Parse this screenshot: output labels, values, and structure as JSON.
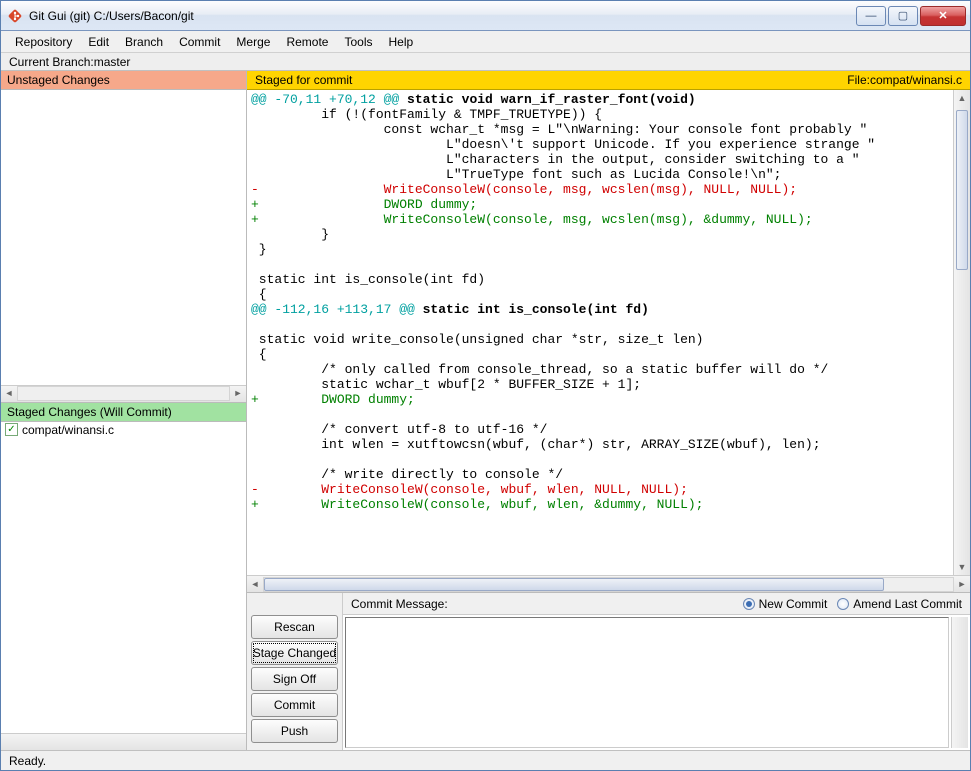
{
  "window": {
    "title": "Git Gui (git) C:/Users/Bacon/git"
  },
  "menu": {
    "items": [
      "Repository",
      "Edit",
      "Branch",
      "Commit",
      "Merge",
      "Remote",
      "Tools",
      "Help"
    ]
  },
  "branch_label_prefix": "Current Branch: ",
  "branch_name": "master",
  "panels": {
    "unstaged_header": "Unstaged Changes",
    "staged_header": "Staged Changes (Will Commit)"
  },
  "staged_files": [
    {
      "name": "compat/winansi.c"
    }
  ],
  "diff_header": {
    "left": "Staged for commit",
    "file_prefix": "File:  ",
    "file": "compat/winansi.c"
  },
  "diff_lines": [
    {
      "cls": "hunk",
      "t": "@@ -70,11 +70,12 @@",
      "bold": " static void warn_if_raster_font(void)"
    },
    {
      "cls": "ctx",
      "t": "         if (!(fontFamily & TMPF_TRUETYPE)) {"
    },
    {
      "cls": "ctx",
      "t": "                 const wchar_t *msg = L\"\\nWarning: Your console font probably \""
    },
    {
      "cls": "ctx",
      "t": "                         L\"doesn\\'t support Unicode. If you experience strange \""
    },
    {
      "cls": "ctx",
      "t": "                         L\"characters in the output, consider switching to a \""
    },
    {
      "cls": "ctx",
      "t": "                         L\"TrueType font such as Lucida Console!\\n\";"
    },
    {
      "cls": "del",
      "t": "-                WriteConsoleW(console, msg, wcslen(msg), NULL, NULL);"
    },
    {
      "cls": "add",
      "t": "+                DWORD dummy;"
    },
    {
      "cls": "add",
      "t": "+                WriteConsoleW(console, msg, wcslen(msg), &dummy, NULL);"
    },
    {
      "cls": "ctx",
      "t": "         }"
    },
    {
      "cls": "ctx",
      "t": " }"
    },
    {
      "cls": "ctx",
      "t": " "
    },
    {
      "cls": "ctx",
      "t": " static int is_console(int fd)"
    },
    {
      "cls": "ctx",
      "t": " {"
    },
    {
      "cls": "hunk",
      "t": "@@ -112,16 +113,17 @@",
      "bold": " static int is_console(int fd)"
    },
    {
      "cls": "ctx",
      "t": " "
    },
    {
      "cls": "ctx",
      "t": " static void write_console(unsigned char *str, size_t len)"
    },
    {
      "cls": "ctx",
      "t": " {"
    },
    {
      "cls": "ctx",
      "t": "         /* only called from console_thread, so a static buffer will do */"
    },
    {
      "cls": "ctx",
      "t": "         static wchar_t wbuf[2 * BUFFER_SIZE + 1];"
    },
    {
      "cls": "add",
      "t": "+        DWORD dummy;"
    },
    {
      "cls": "ctx",
      "t": " "
    },
    {
      "cls": "ctx",
      "t": "         /* convert utf-8 to utf-16 */"
    },
    {
      "cls": "ctx",
      "t": "         int wlen = xutftowcsn(wbuf, (char*) str, ARRAY_SIZE(wbuf), len);"
    },
    {
      "cls": "ctx",
      "t": " "
    },
    {
      "cls": "ctx",
      "t": "         /* write directly to console */"
    },
    {
      "cls": "del",
      "t": "-        WriteConsoleW(console, wbuf, wlen, NULL, NULL);"
    },
    {
      "cls": "add",
      "t": "+        WriteConsoleW(console, wbuf, wlen, &dummy, NULL);"
    }
  ],
  "commit": {
    "msg_label": "Commit Message:",
    "radio_new": "New Commit",
    "radio_amend": "Amend Last Commit",
    "buttons": {
      "rescan": "Rescan",
      "stage": "Stage Changed",
      "signoff": "Sign Off",
      "commit": "Commit",
      "push": "Push"
    },
    "message": ""
  },
  "status": "Ready."
}
